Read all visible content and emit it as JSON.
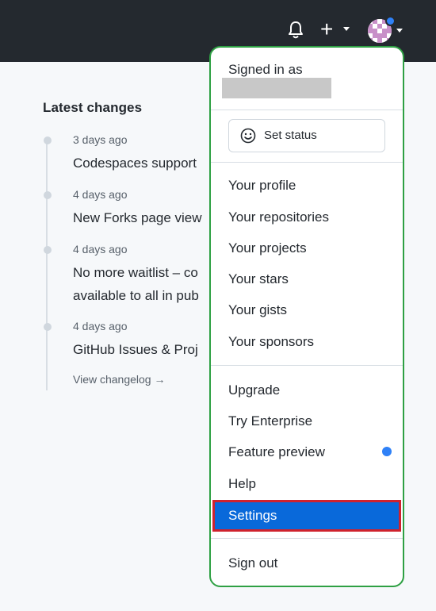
{
  "header": {
    "bell_icon": "bell-icon",
    "plus_label": "+",
    "avatar_icon": "identicon-avatar",
    "notification_dot_color": "#2f81f7"
  },
  "changes": {
    "heading": "Latest changes",
    "items": [
      {
        "date": "3 days ago",
        "title": "Codespaces support"
      },
      {
        "date": "4 days ago",
        "title": "New Forks page view"
      },
      {
        "date": "4 days ago",
        "title": "No more waitlist – co\navailable to all in pub"
      },
      {
        "date": "4 days ago",
        "title": "GitHub Issues & Proj"
      }
    ],
    "view_changelog": "View changelog →"
  },
  "menu": {
    "signed_in_as": "Signed in as",
    "set_status": "Set status",
    "profile_items": [
      "Your profile",
      "Your repositories",
      "Your projects",
      "Your stars",
      "Your gists",
      "Your sponsors"
    ],
    "upgrade": "Upgrade",
    "try_enterprise": "Try Enterprise",
    "feature_preview": "Feature preview",
    "help": "Help",
    "settings": "Settings",
    "sign_out": "Sign out",
    "highlight_color": "#0969da",
    "outline_color": "#2ea043"
  }
}
